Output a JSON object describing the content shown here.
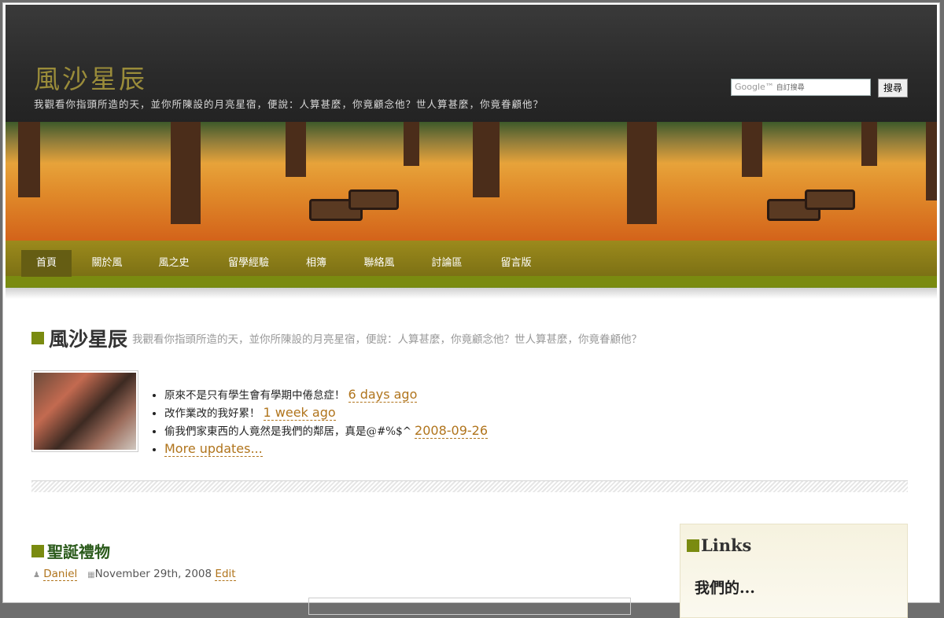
{
  "header": {
    "site_title": "風沙星辰",
    "site_description": "我觀看你指頭所造的天，並你所陳設的月亮星宿，便說：人算甚麼，你竟顧念他？世人算甚麼，你竟眷顧他？",
    "search": {
      "brand": "Google™",
      "placeholder": "自訂搜尋",
      "button_label": "搜尋"
    }
  },
  "nav": {
    "items": [
      {
        "label": "首頁",
        "active": true
      },
      {
        "label": "關於風"
      },
      {
        "label": "風之史"
      },
      {
        "label": "留學經驗"
      },
      {
        "label": "相簿"
      },
      {
        "label": "聯絡風"
      },
      {
        "label": "討論區"
      },
      {
        "label": "留言版"
      }
    ]
  },
  "intro": {
    "title": "風沙星辰",
    "description": "我觀看你指頭所造的天，並你所陳設的月亮星宿，便說：人算甚麼，你竟顧念他？世人算甚麼，你竟眷顧他？"
  },
  "updates": {
    "items": [
      {
        "text": "原來不是只有學生會有學期中倦怠症！",
        "time": "6 days ago"
      },
      {
        "text": "改作業改的我好累！",
        "time": "1 week ago"
      },
      {
        "text": "偷我們家東西的人竟然是我們的鄰居，真是@#%$^",
        "time": "2008-09-26"
      }
    ],
    "more_label": "More updates..."
  },
  "post": {
    "title": "聖誕禮物",
    "author": "Daniel",
    "date": "November 29th, 2008",
    "edit_label": "Edit"
  },
  "sidebar": {
    "title": "Links",
    "subtitle": "我們的..."
  },
  "colors": {
    "accent": "#7a8b10",
    "link": "#b0741c",
    "header_bg": "#2a2a2a"
  }
}
